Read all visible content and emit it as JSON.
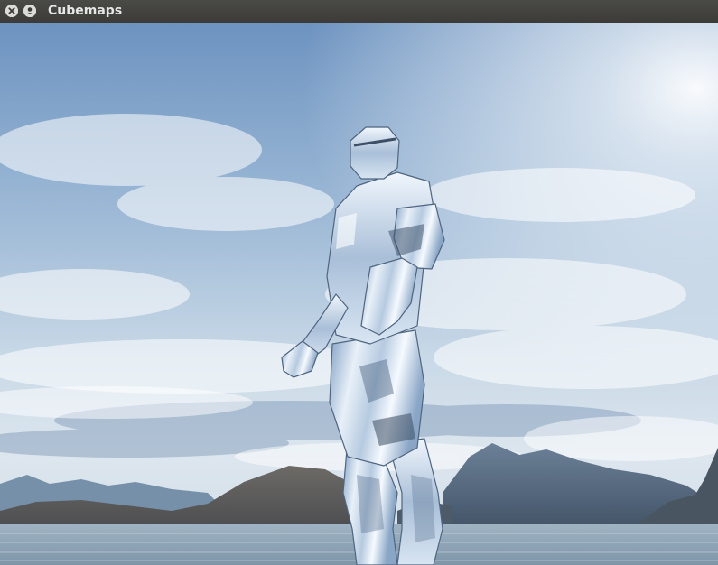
{
  "window": {
    "title": "Cubemaps",
    "buttons": [
      {
        "name": "close",
        "icon": "close-icon"
      },
      {
        "name": "minimize",
        "icon": "minimize-icon"
      }
    ]
  },
  "scene": {
    "description_icon": "rendered-3d-scene",
    "colors": {
      "sky_top": "#6f97c4",
      "sky_mid": "#a9c4dd",
      "sky_horizon": "#e3ecf2",
      "mountains": "#566a7e",
      "water": "#8ea4b6",
      "model": "#c9d9ea"
    }
  }
}
